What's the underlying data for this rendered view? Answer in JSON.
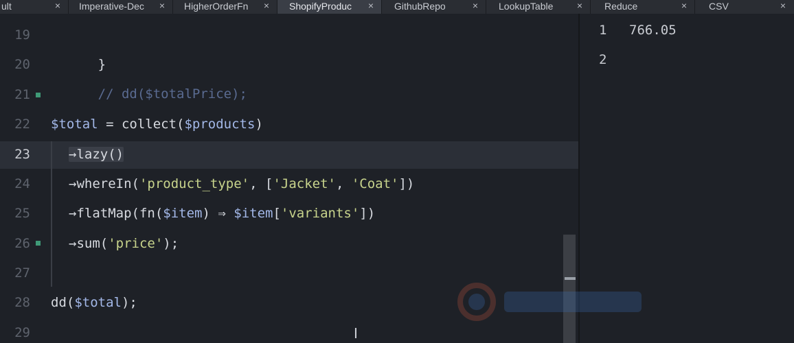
{
  "tabs": [
    {
      "label": "ult",
      "close": "×"
    },
    {
      "label": "Imperative-Dec",
      "close": "×"
    },
    {
      "label": "HigherOrderFn",
      "close": "×"
    },
    {
      "label": "ShopifyProduc",
      "close": "×"
    },
    {
      "label": "GithubRepo",
      "close": "×"
    },
    {
      "label": "LookupTable",
      "close": "×"
    },
    {
      "label": "Reduce",
      "close": "×"
    },
    {
      "label": "CSV",
      "close": "×"
    }
  ],
  "active_tab_index": 3,
  "editor": {
    "line_numbers": [
      "19",
      "20",
      "21",
      "22",
      "23",
      "24",
      "25",
      "26",
      "27",
      "28",
      "29"
    ],
    "current_line": "23",
    "code": {
      "l19": {
        "a": "}"
      },
      "l20": {
        "a": "// dd($totalPrice);"
      },
      "l22": {
        "a": "$total",
        "b": " = collect(",
        "c": "$products",
        "d": ")"
      },
      "l23": {
        "a": "→lazy()"
      },
      "l24": {
        "a": "→whereIn(",
        "b": "'product_type'",
        "c": ", [",
        "d": "'Jacket'",
        "e": ", ",
        "f": "'Coat'",
        "g": "])"
      },
      "l25": {
        "a": "→flatMap(fn(",
        "b": "$item",
        "c": ") ⇒ ",
        "d": "$item",
        "e": "[",
        "f": "'variants'",
        "g": "])"
      },
      "l26": {
        "a": "→sum(",
        "b": "'price'",
        "c": ");"
      },
      "l28": {
        "a": "dd(",
        "b": "$total",
        "c": ");"
      }
    }
  },
  "output": {
    "lines": [
      {
        "num": "1",
        "value": "766.05"
      },
      {
        "num": "2",
        "value": ""
      }
    ]
  },
  "colors": {
    "background": "#1e2127",
    "variable": "#a3b8e8",
    "string": "#c8d48c",
    "comment": "#5a6b91",
    "gutter_marker": "#3f9a77"
  },
  "icons": {
    "tab_close": "close-icon",
    "cursor": "text-cursor-icon",
    "watermark": "watermark-logo"
  }
}
